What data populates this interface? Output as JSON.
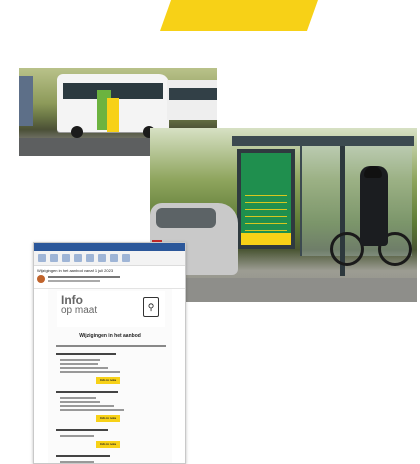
{
  "colors": {
    "accent_yellow": "#f7d117",
    "bus_green": "#6cb33f",
    "billboard_green": "#1f8f4e"
  },
  "email": {
    "subject": "Wijzigingen in het aanbod vanaf 1 juli 2023",
    "brand_line1": "Info",
    "brand_line2": "op maat",
    "icon_name": "bus-stop-icon",
    "heading": "Wijzigingen in het aanbod",
    "cta_label": "Info in nota"
  }
}
